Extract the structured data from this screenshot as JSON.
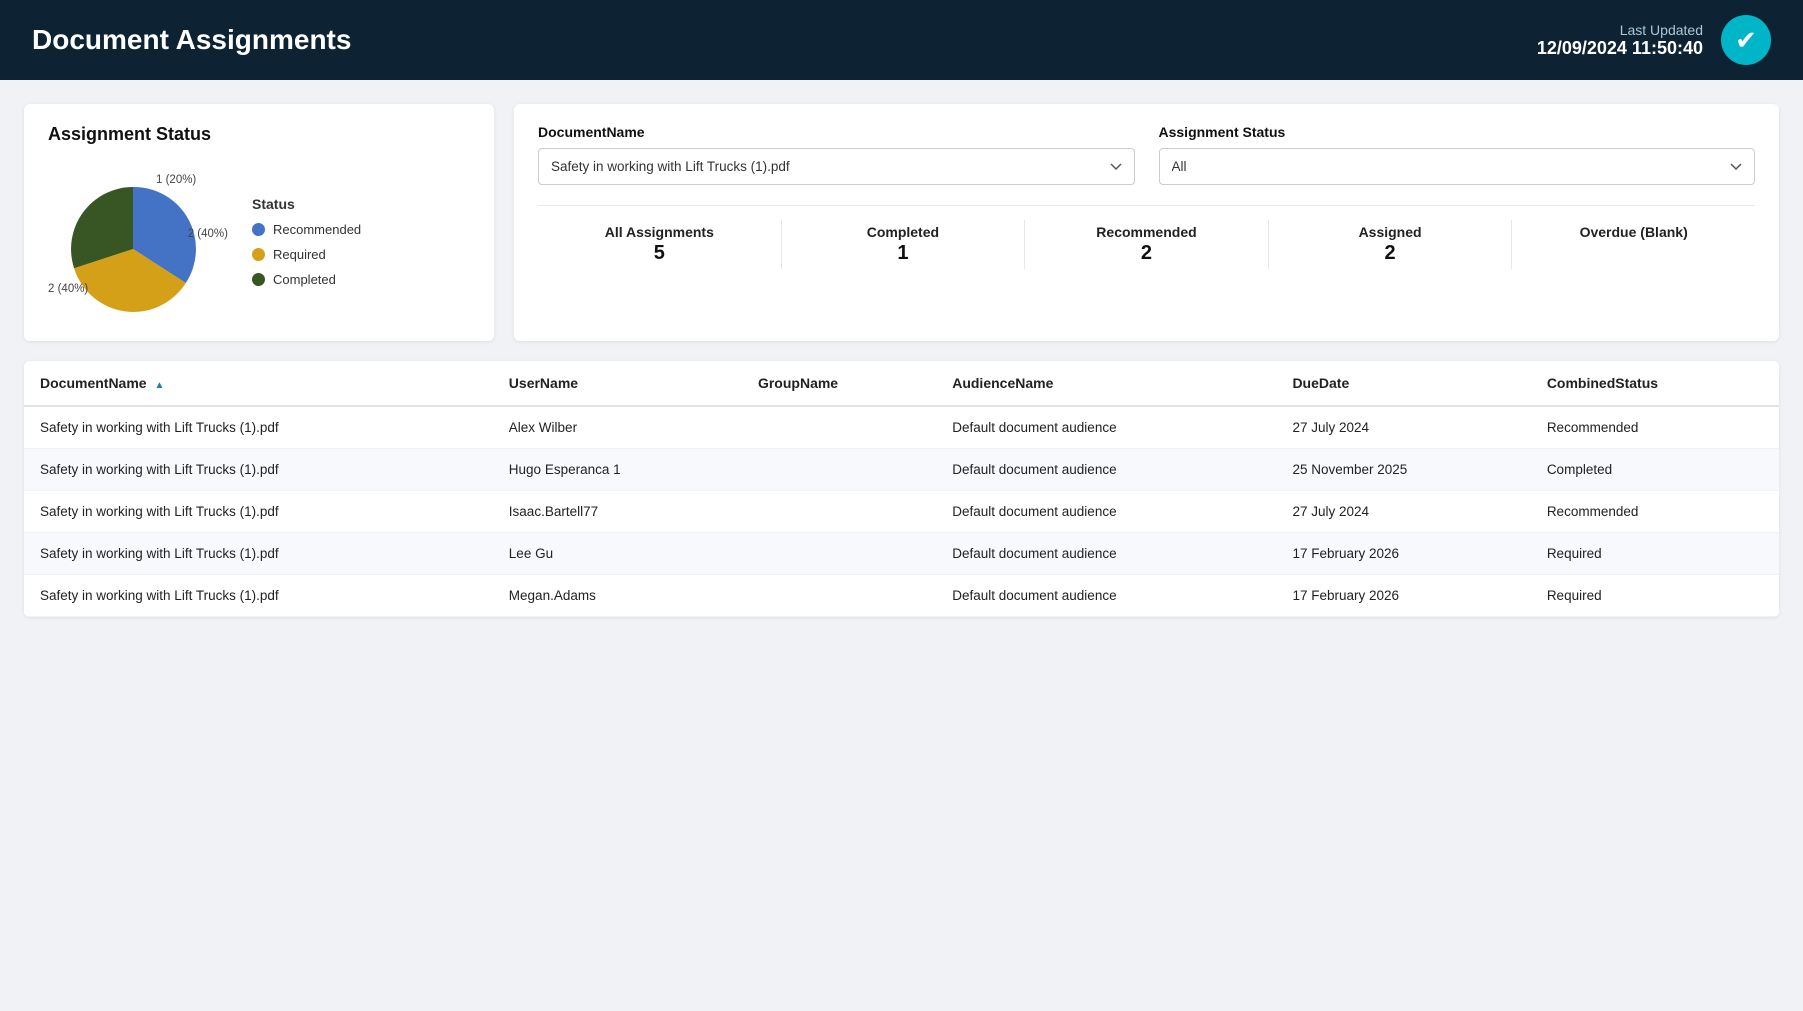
{
  "header": {
    "title": "Document Assignments",
    "last_updated_label": "Last Updated",
    "last_updated_time": "12/09/2024 11:50:40",
    "icon_symbol": "✔"
  },
  "status_card": {
    "title": "Assignment Status",
    "legend": [
      {
        "label": "Recommended",
        "color": "#4472c4"
      },
      {
        "label": "Required",
        "color": "#d4a017"
      },
      {
        "label": "Completed",
        "color": "#375623"
      }
    ],
    "pie_labels": [
      {
        "text": "1 (20%)",
        "top": "12%",
        "left": "62%"
      },
      {
        "text": "2 (40%)",
        "top": "38%",
        "right": "2%"
      },
      {
        "text": "2 (40%)",
        "top": "78%",
        "left": "2%"
      }
    ]
  },
  "filters": {
    "document_name_label": "DocumentName",
    "document_name_value": "Safety in working with Lift Trucks (1).pdf",
    "document_name_placeholder": "Safety in working with Lift Trucks (1).pdf",
    "assignment_status_label": "Assignment Status",
    "assignment_status_value": "All",
    "assignment_status_options": [
      "All",
      "Completed",
      "Recommended",
      "Assigned",
      "Overdue"
    ]
  },
  "summary": [
    {
      "label": "All Assignments",
      "value": "5"
    },
    {
      "label": "Completed",
      "value": "1"
    },
    {
      "label": "Recommended",
      "value": "2"
    },
    {
      "label": "Assigned",
      "value": "2"
    },
    {
      "label": "Overdue (Blank)",
      "value": ""
    }
  ],
  "table": {
    "columns": [
      {
        "key": "documentName",
        "label": "DocumentName",
        "sortable": true
      },
      {
        "key": "userName",
        "label": "UserName",
        "sortable": false
      },
      {
        "key": "groupName",
        "label": "GroupName",
        "sortable": false
      },
      {
        "key": "audienceName",
        "label": "AudienceName",
        "sortable": false
      },
      {
        "key": "dueDate",
        "label": "DueDate",
        "sortable": false
      },
      {
        "key": "combinedStatus",
        "label": "CombinedStatus",
        "sortable": false
      }
    ],
    "rows": [
      {
        "documentName": "Safety in working with Lift Trucks (1).pdf",
        "userName": "Alex Wilber",
        "groupName": "",
        "audienceName": "Default document audience",
        "dueDate": "27 July 2024",
        "combinedStatus": "Recommended"
      },
      {
        "documentName": "Safety in working with Lift Trucks (1).pdf",
        "userName": "Hugo Esperanca 1",
        "groupName": "",
        "audienceName": "Default document audience",
        "dueDate": "25 November 2025",
        "combinedStatus": "Completed"
      },
      {
        "documentName": "Safety in working with Lift Trucks (1).pdf",
        "userName": "Isaac.Bartell77",
        "groupName": "",
        "audienceName": "Default document audience",
        "dueDate": "27 July 2024",
        "combinedStatus": "Recommended"
      },
      {
        "documentName": "Safety in working with Lift Trucks (1).pdf",
        "userName": "Lee Gu",
        "groupName": "",
        "audienceName": "Default document audience",
        "dueDate": "17 February 2026",
        "combinedStatus": "Required"
      },
      {
        "documentName": "Safety in working with Lift Trucks (1).pdf",
        "userName": "Megan.Adams",
        "groupName": "",
        "audienceName": "Default document audience",
        "dueDate": "17 February 2026",
        "combinedStatus": "Required"
      }
    ]
  }
}
